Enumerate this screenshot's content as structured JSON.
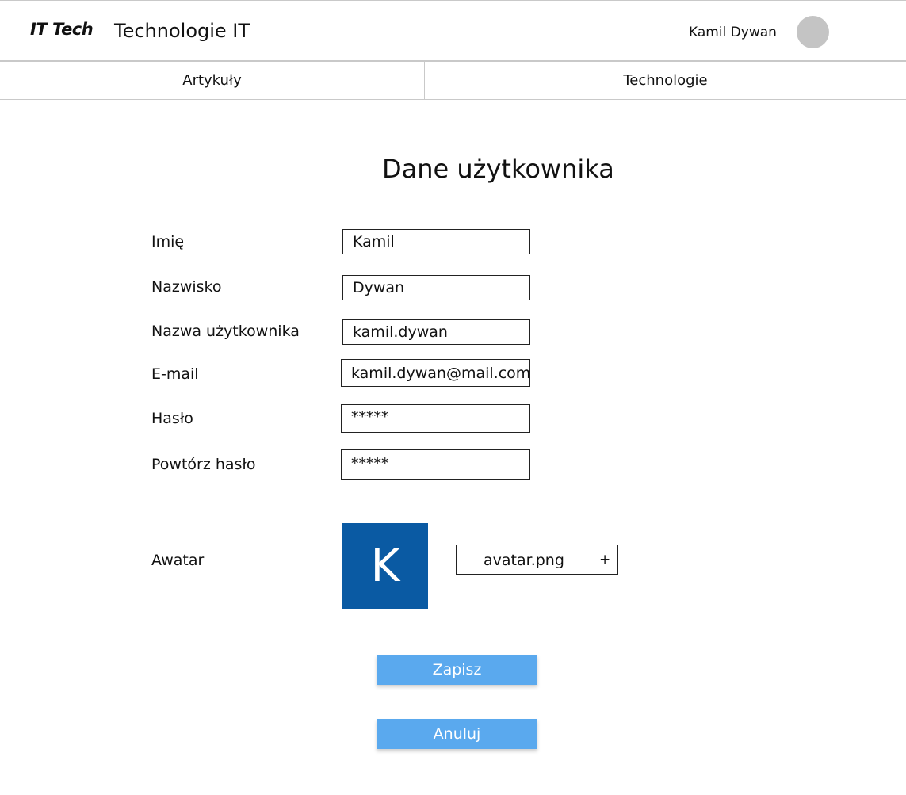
{
  "header": {
    "logo": "IT Tech",
    "site_title": "Technologie IT",
    "user_name": "Kamil Dywan"
  },
  "nav": {
    "items": [
      {
        "label": "Artykuły"
      },
      {
        "label": "Technologie"
      }
    ]
  },
  "form": {
    "title": "Dane użytkownika",
    "first_name": {
      "label": "Imię",
      "value": "Kamil"
    },
    "last_name": {
      "label": "Nazwisko",
      "value": "Dywan"
    },
    "username": {
      "label": "Nazwa użytkownika",
      "value": "kamil.dywan"
    },
    "email": {
      "label": "E-mail",
      "value": "kamil.dywan@mail.com"
    },
    "password": {
      "label": "Hasło",
      "value": "*****"
    },
    "password_repeat": {
      "label": "Powtórz hasło",
      "value": "*****"
    },
    "avatar": {
      "label": "Awatar",
      "initial": "K",
      "file_name": "avatar.png",
      "add_symbol": "+"
    },
    "save_label": "Zapisz",
    "cancel_label": "Anuluj"
  },
  "colors": {
    "avatar_bg": "#0a5aa3",
    "button_bg": "#5aa9ee",
    "header_avatar": "#c4c4c4"
  }
}
